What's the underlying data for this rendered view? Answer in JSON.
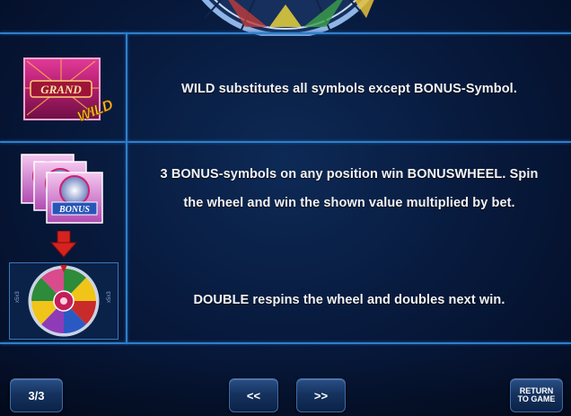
{
  "rules": [
    {
      "text": "WILD substitutes all symbols except BONUS-Symbol."
    },
    {
      "text_line1": "3 BONUS-symbols on any position win BONUSWHEEL. Spin",
      "text_line2": "the wheel and win the shown value multiplied by bet."
    },
    {
      "text": "DOUBLE respins the wheel and doubles next win."
    }
  ],
  "symbols": {
    "wild_logo": "GRAND",
    "wild_tag": "WILD",
    "bonus_label": "BONUS"
  },
  "footer": {
    "page_indicator": "3/3",
    "prev_label": "<<",
    "next_label": ">>",
    "return_line1": "RETURN",
    "return_line2": "TO GAME"
  },
  "colors": {
    "accent_line": "#2f7fc8",
    "background": "#07183a"
  }
}
